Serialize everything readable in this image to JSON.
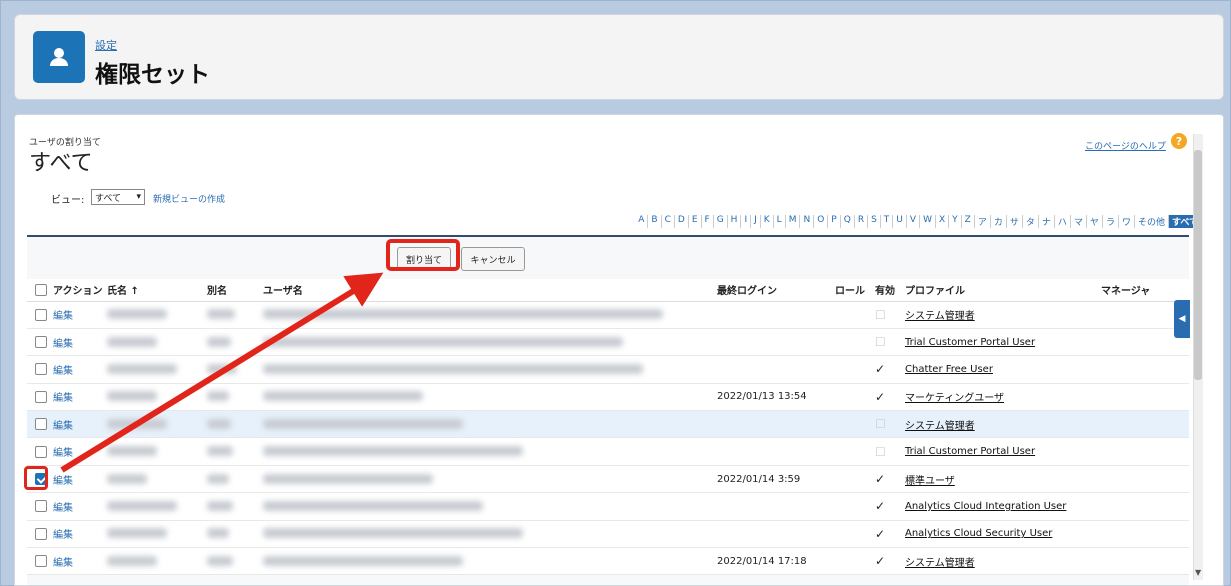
{
  "header": {
    "sub_label": "設定",
    "title": "権限セット",
    "icon": "user-icon"
  },
  "page": {
    "small_label": "ユーザの割り当て",
    "title": "すべて",
    "help_link": "このページのヘルプ",
    "view_label": "ビュー:",
    "view_value": "すべて",
    "new_view_link": "新規ビューの作成"
  },
  "alphabet": [
    "A",
    "B",
    "C",
    "D",
    "E",
    "F",
    "G",
    "H",
    "I",
    "J",
    "K",
    "L",
    "M",
    "N",
    "O",
    "P",
    "Q",
    "R",
    "S",
    "T",
    "U",
    "V",
    "W",
    "X",
    "Y",
    "Z",
    "ア",
    "カ",
    "サ",
    "タ",
    "ナ",
    "ハ",
    "マ",
    "ヤ",
    "ラ",
    "ワ",
    "その他",
    "すべて"
  ],
  "buttons": {
    "assign": "割り当て",
    "cancel": "キャンセル"
  },
  "table": {
    "headers": {
      "action": "アクション",
      "name": "氏名 ↑",
      "alias": "別名",
      "username": "ユーザ名",
      "last_login": "最終ログイン",
      "role": "ロール",
      "active": "有効",
      "profile": "プロファイル",
      "manager": "マネージャ"
    },
    "rows": [
      {
        "action": "編集",
        "last_login": "",
        "active": false,
        "profile": "システム管理者",
        "checked": false
      },
      {
        "action": "編集",
        "last_login": "",
        "active": false,
        "profile": "Trial Customer Portal User",
        "checked": false
      },
      {
        "action": "編集",
        "last_login": "",
        "active": true,
        "profile": "Chatter Free User",
        "checked": false
      },
      {
        "action": "編集",
        "last_login": "2022/01/13 13:54",
        "active": true,
        "profile": "マーケティングユーザ",
        "checked": false
      },
      {
        "action": "編集",
        "last_login": "",
        "active": false,
        "profile": "システム管理者",
        "checked": false
      },
      {
        "action": "編集",
        "last_login": "",
        "active": false,
        "profile": "Trial Customer Portal User",
        "checked": false
      },
      {
        "action": "編集",
        "last_login": "2022/01/14 3:59",
        "active": true,
        "profile": "標準ユーザ",
        "checked": true
      },
      {
        "action": "編集",
        "last_login": "",
        "active": true,
        "profile": "Analytics Cloud Integration User",
        "checked": false
      },
      {
        "action": "編集",
        "last_login": "",
        "active": true,
        "profile": "Analytics Cloud Security User",
        "checked": false
      },
      {
        "action": "編集",
        "last_login": "2022/01/14 17:18",
        "active": true,
        "profile": "システム管理者",
        "checked": false
      }
    ]
  },
  "colors": {
    "brand": "#1c73b6",
    "highlight": "#e1251b"
  }
}
